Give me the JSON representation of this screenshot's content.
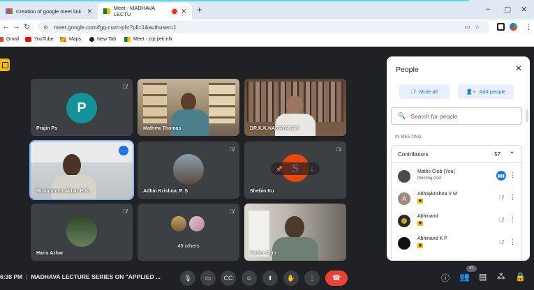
{
  "browser": {
    "tabs": [
      {
        "title": "Creation of google meet link",
        "active": false
      },
      {
        "title": "Meet - MADHAVA LECTU",
        "active": true
      }
    ],
    "new_tab": "+",
    "window": {
      "minimize": "–",
      "restore": "▢",
      "close": "✕"
    },
    "url": "meet.google.com/fgq-cuzn-phr?pli=1&authuser=1",
    "bookmarks": [
      "Gmail",
      "YouTube",
      "Maps",
      "New Tab",
      "Meet - zqt-jtek-nfx"
    ]
  },
  "tiles": [
    {
      "name": "Prajin Ps",
      "initial": "P",
      "avatar_color": "#12939a",
      "muted": true
    },
    {
      "name": "Mathew Thomas",
      "muted": false
    },
    {
      "name": "DR.K.K.NARAYANAN",
      "muted": false
    },
    {
      "name": "Muhammed Akbar P. K.",
      "muted": false,
      "active": true
    },
    {
      "name": "Adhin Krishna. P. S",
      "muted": true
    },
    {
      "name": "Shebin Ku",
      "initial": "S",
      "avatar_color": "#e8470f",
      "muted": true
    },
    {
      "name": "Haris Azhar",
      "muted": true
    },
    {
      "name": "49 others",
      "muted": true
    },
    {
      "name": "Maths Club",
      "muted": false
    }
  ],
  "people_panel": {
    "title": "People",
    "mute_all": "Mute all",
    "add_people": "Add people",
    "search_placeholder": "Search for people",
    "section_label": "IN MEETING",
    "group": "Contributors",
    "count": "57",
    "participants": [
      {
        "name": "Maths Club (You)",
        "subtitle": "Meeting host",
        "color": "#4a4a4a",
        "initial": "",
        "state": "speaking"
      },
      {
        "name": "Abhaykrishna V M",
        "subtitle": "",
        "color": "#a1887f",
        "initial": "A",
        "state": "muted"
      },
      {
        "name": "Abhinand",
        "subtitle": "",
        "color": "#2b2b1a",
        "initial": "",
        "state": "muted"
      },
      {
        "name": "Abhinand K P",
        "subtitle": "",
        "color": "#111111",
        "initial": "",
        "state": "muted"
      }
    ]
  },
  "bottom_bar": {
    "time": "6:38 PM",
    "meeting_title": "MADHAVA LECTURE SERIES ON \"APPLIED ...",
    "participant_count": "57"
  }
}
